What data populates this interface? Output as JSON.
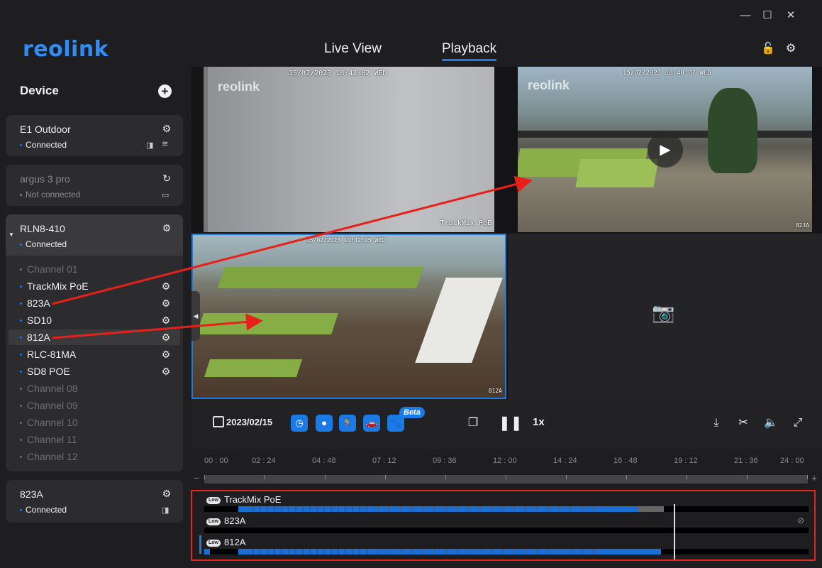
{
  "app": {
    "logo": "reolink",
    "tabs": [
      {
        "label": "Live View"
      },
      {
        "label": "Playback"
      }
    ],
    "active_tab": "Playback",
    "window": {
      "minimize": "—",
      "maximize": "☐",
      "close": "✕"
    }
  },
  "sidebar": {
    "title": "Device",
    "devices": [
      {
        "name": "E1 Outdoor",
        "status": "Connected"
      },
      {
        "name": "argus 3 pro",
        "status": "Not connected"
      },
      {
        "name": "RLN8-410",
        "status": "Connected"
      },
      {
        "name": "823A",
        "status": "Connected"
      }
    ],
    "channels": [
      {
        "label": "Channel 01"
      },
      {
        "label": "TrackMix PoE"
      },
      {
        "label": "823A"
      },
      {
        "label": "SD10"
      },
      {
        "label": "812A"
      },
      {
        "label": "RLC-81MA"
      },
      {
        "label": "SD8 POE"
      },
      {
        "label": "Channel 08"
      },
      {
        "label": "Channel 09"
      },
      {
        "label": "Channel 10"
      },
      {
        "label": "Channel 11"
      },
      {
        "label": "Channel 12"
      }
    ]
  },
  "videos": {
    "cell1": {
      "timestamp": "15/02/2023 18:42:02 WED",
      "watermark": "reolink",
      "label": "TrackMix PoE"
    },
    "cell2": {
      "timestamp": "15/02/2023 18:40:07 WED",
      "watermark": "reolink",
      "label": "823A"
    },
    "cell3": {
      "timestamp": "15/02/2023 10:42:05 WED",
      "label": "812A"
    }
  },
  "controls": {
    "date": "2023/02/15",
    "beta": "Beta",
    "speed": "1x"
  },
  "timeline": {
    "ticks": [
      "00 : 00",
      "02 : 24",
      "04 : 48",
      "07 : 12",
      "09 : 36",
      "12 : 00",
      "14 : 24",
      "16 : 48",
      "19 : 12",
      "21 : 36",
      "24 : 00"
    ],
    "minus": "−",
    "plus": "+",
    "tracks": [
      {
        "quality": "Low",
        "name": "TrackMix PoE"
      },
      {
        "quality": "Low",
        "name": "823A"
      },
      {
        "quality": "Low",
        "name": "812A"
      }
    ]
  },
  "colors": {
    "accent": "#1a7ae8",
    "highlight_border": "#e4271c",
    "annotation_arrow": "#e8201a"
  }
}
